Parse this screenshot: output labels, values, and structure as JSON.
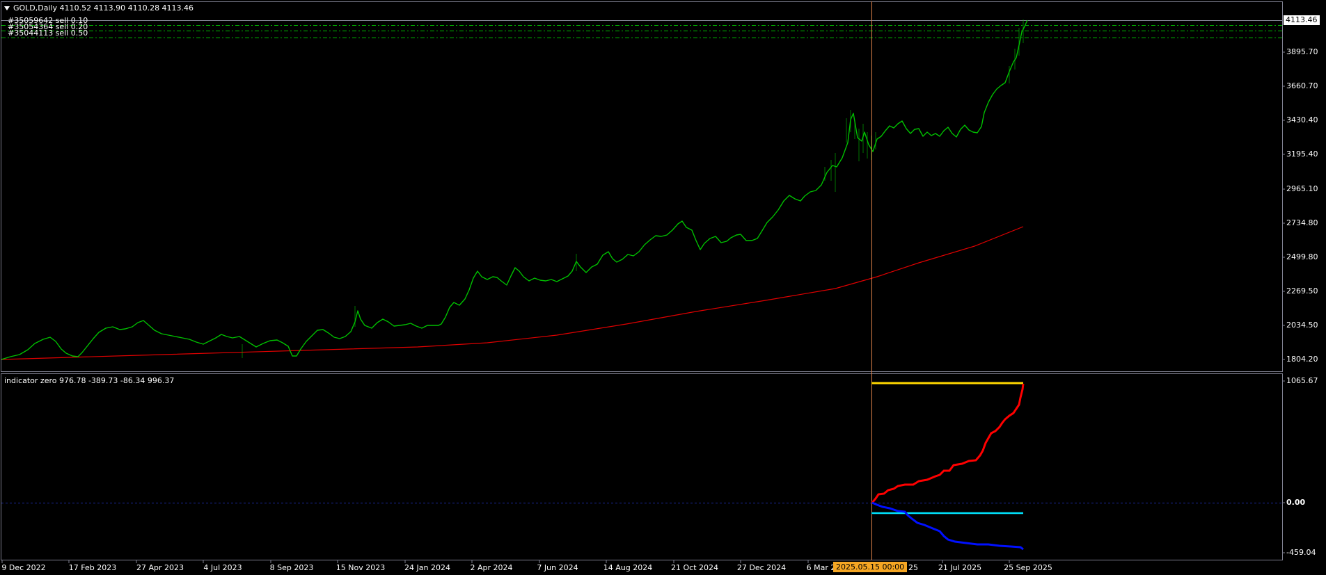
{
  "main_chart": {
    "header": "GOLD,Daily  4110.52 4113.90 4110.28 4113.46",
    "current_price": "4113.46",
    "price_labels": [
      "3895.70",
      "3660.70",
      "3430.40",
      "3195.40",
      "2965.10",
      "2734.80",
      "2499.80",
      "2269.50",
      "2034.50",
      "1804.20"
    ],
    "orders": [
      {
        "label": "#35059642 sell 0.10"
      },
      {
        "label": "#35054364 sell 0.20"
      },
      {
        "label": "#35044113 sell 0.50"
      }
    ],
    "colors": {
      "candles": "#00c000",
      "ma": "#e00000",
      "orders": "#00c000",
      "cursor": "#e0834a",
      "grid": "#7f8090"
    }
  },
  "indicator": {
    "header": "indicator zero 976.78 -389.73 -86.34 996.37",
    "labels": [
      "1065.67",
      "0.00",
      "-459.04"
    ],
    "colors": {
      "yellow": "#ffd700",
      "red": "#ff0000",
      "cyan": "#00e5ff",
      "blue": "#0010ff",
      "zero": "#1a2aa0"
    }
  },
  "time_axis": {
    "labels": [
      "9 Dec 2022",
      "17 Feb 2023",
      "27 Apr 2023",
      "4 Jul 2023",
      "8 Sep 2023",
      "15 Nov 2023",
      "24 Jan 2024",
      "2 Apr 2024",
      "7 Jun 2024",
      "14 Aug 2024",
      "21 Oct 2024",
      "27 Dec 2024",
      "6 Mar 2025",
      "21 Jul 2025",
      "25 Sep 2025"
    ],
    "cursor_time": "2025.05.15 00:00",
    "cursor_tail": "25"
  }
}
